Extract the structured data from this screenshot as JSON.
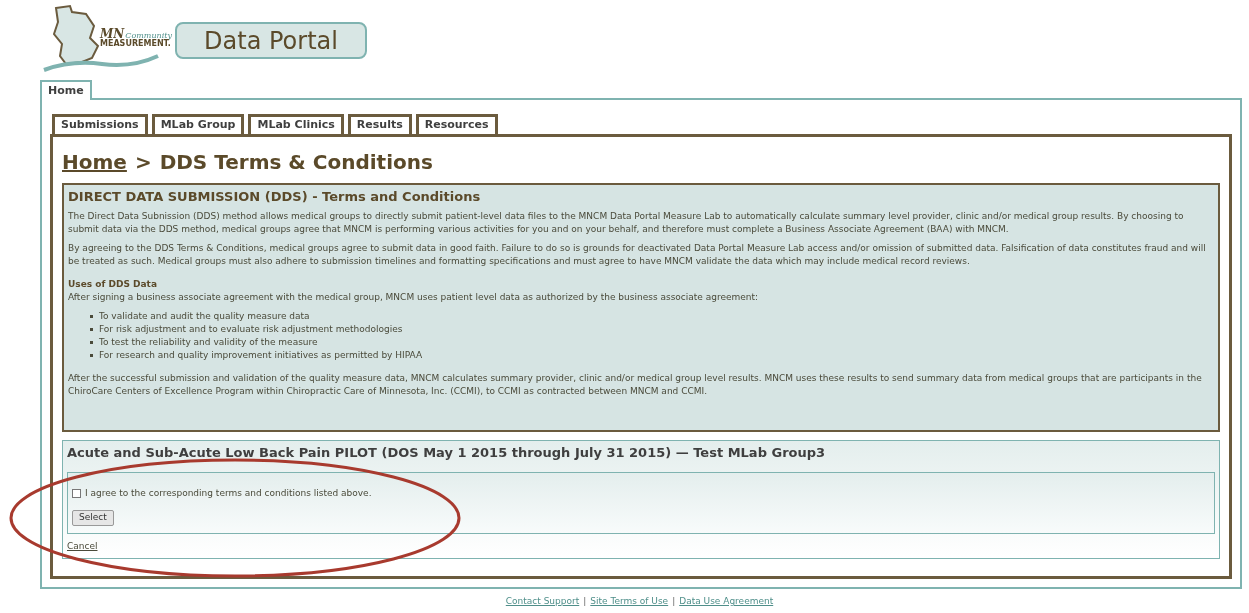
{
  "logo": {
    "line_1": "MN",
    "line_2": "Community",
    "line_3": "MEASUREMENT."
  },
  "portal_title": "Data Portal",
  "main_tabs": [
    {
      "label": "Home",
      "selected": true
    }
  ],
  "sub_tabs": [
    {
      "label": "Submissions",
      "selected": false
    },
    {
      "label": "MLab Group",
      "selected": false
    },
    {
      "label": "MLab Clinics",
      "selected": false
    },
    {
      "label": "Results",
      "selected": false
    },
    {
      "label": "Resources",
      "selected": false
    }
  ],
  "breadcrumb": {
    "link": "Home",
    "separator": ">",
    "current": "DDS Terms & Conditions"
  },
  "terms": {
    "title": "DIRECT DATA SUBMISSION (DDS) - Terms and Conditions",
    "paragraphs": [
      "The Direct Data Subnission (DDS) method allows medical groups to directly submit patient-level data files to the MNCM Data Portal Measure Lab to automatically calculate summary level provider, clinic and/or medical group results. By choosing to submit data via the DDS method, medical groups agree that MNCM is performing various activities for you and on your behalf, and therefore must complete a Business Associate Agreement (BAA) with MNCM.",
      "By agreeing to the DDS Terms & Conditions, medical groups agree to submit data in good faith. Failure to do so is grounds for deactivated Data Portal Measure Lab access and/or omission of submitted data. Falsification of data constitutes fraud and will be treated as such. Medical groups must also adhere to submission timelines and formatting specifications and must agree to have MNCM validate the data which may include medical record reviews."
    ],
    "uses_heading": "Uses of DDS Data",
    "uses_intro": "After signing a business associate agreement with the medical group, MNCM uses patient level data as authorized by the business associate agreement:",
    "uses": [
      "To validate and audit the quality measure data",
      "For risk adjustment and to evaluate risk adjustment methodologies",
      "To test the reliability and validity of the measure",
      "For research and quality improvement initiatives as permitted by HIPAA"
    ],
    "closing": "After the successful submission and validation of the quality measure data, MNCM calculates summary provider, clinic and/or medical group level results. MNCM uses these results to send summary data from medical groups that are participants in the ChiroCare Centers of Excellence Program within Chiropractic Care of Minnesota, Inc. (CCMI), to CCMI as contracted between MNCM and CCMI."
  },
  "pilot": {
    "title": "Acute and Sub-Acute Low Back Pain PILOT (DOS May 1 2015 through July 31 2015) — Test MLab Group3",
    "agree": {
      "label": "I agree to the corresponding terms and conditions listed above.",
      "checked": false
    },
    "select_button": "Select",
    "cancel_link": "Cancel"
  },
  "footer_links": [
    "Contact Support",
    "Site Terms of Use",
    "Data Use Agreement"
  ],
  "footer_separator": "|"
}
